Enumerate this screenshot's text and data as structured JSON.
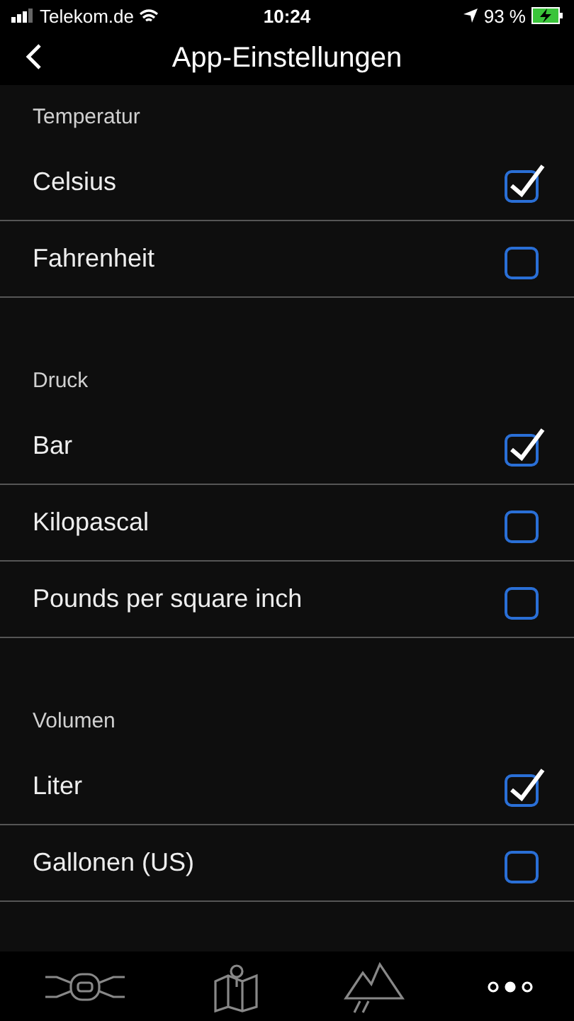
{
  "status_bar": {
    "carrier": "Telekom.de",
    "time": "10:24",
    "battery": "93 %"
  },
  "nav": {
    "title": "App-Einstellungen"
  },
  "sections": [
    {
      "title": "Temperatur",
      "options": [
        {
          "label": "Celsius",
          "checked": true
        },
        {
          "label": "Fahrenheit",
          "checked": false
        }
      ]
    },
    {
      "title": "Druck",
      "options": [
        {
          "label": "Bar",
          "checked": true
        },
        {
          "label": "Kilopascal",
          "checked": false
        },
        {
          "label": "Pounds per square inch",
          "checked": false
        }
      ]
    },
    {
      "title": "Volumen",
      "options": [
        {
          "label": "Liter",
          "checked": true
        },
        {
          "label": "Gallonen (US)",
          "checked": false
        }
      ]
    }
  ],
  "tab_bar": [
    {
      "kind": "vehicle",
      "selected": false
    },
    {
      "kind": "map",
      "selected": false
    },
    {
      "kind": "mountains",
      "selected": false
    },
    {
      "kind": "more",
      "selected": true
    }
  ]
}
